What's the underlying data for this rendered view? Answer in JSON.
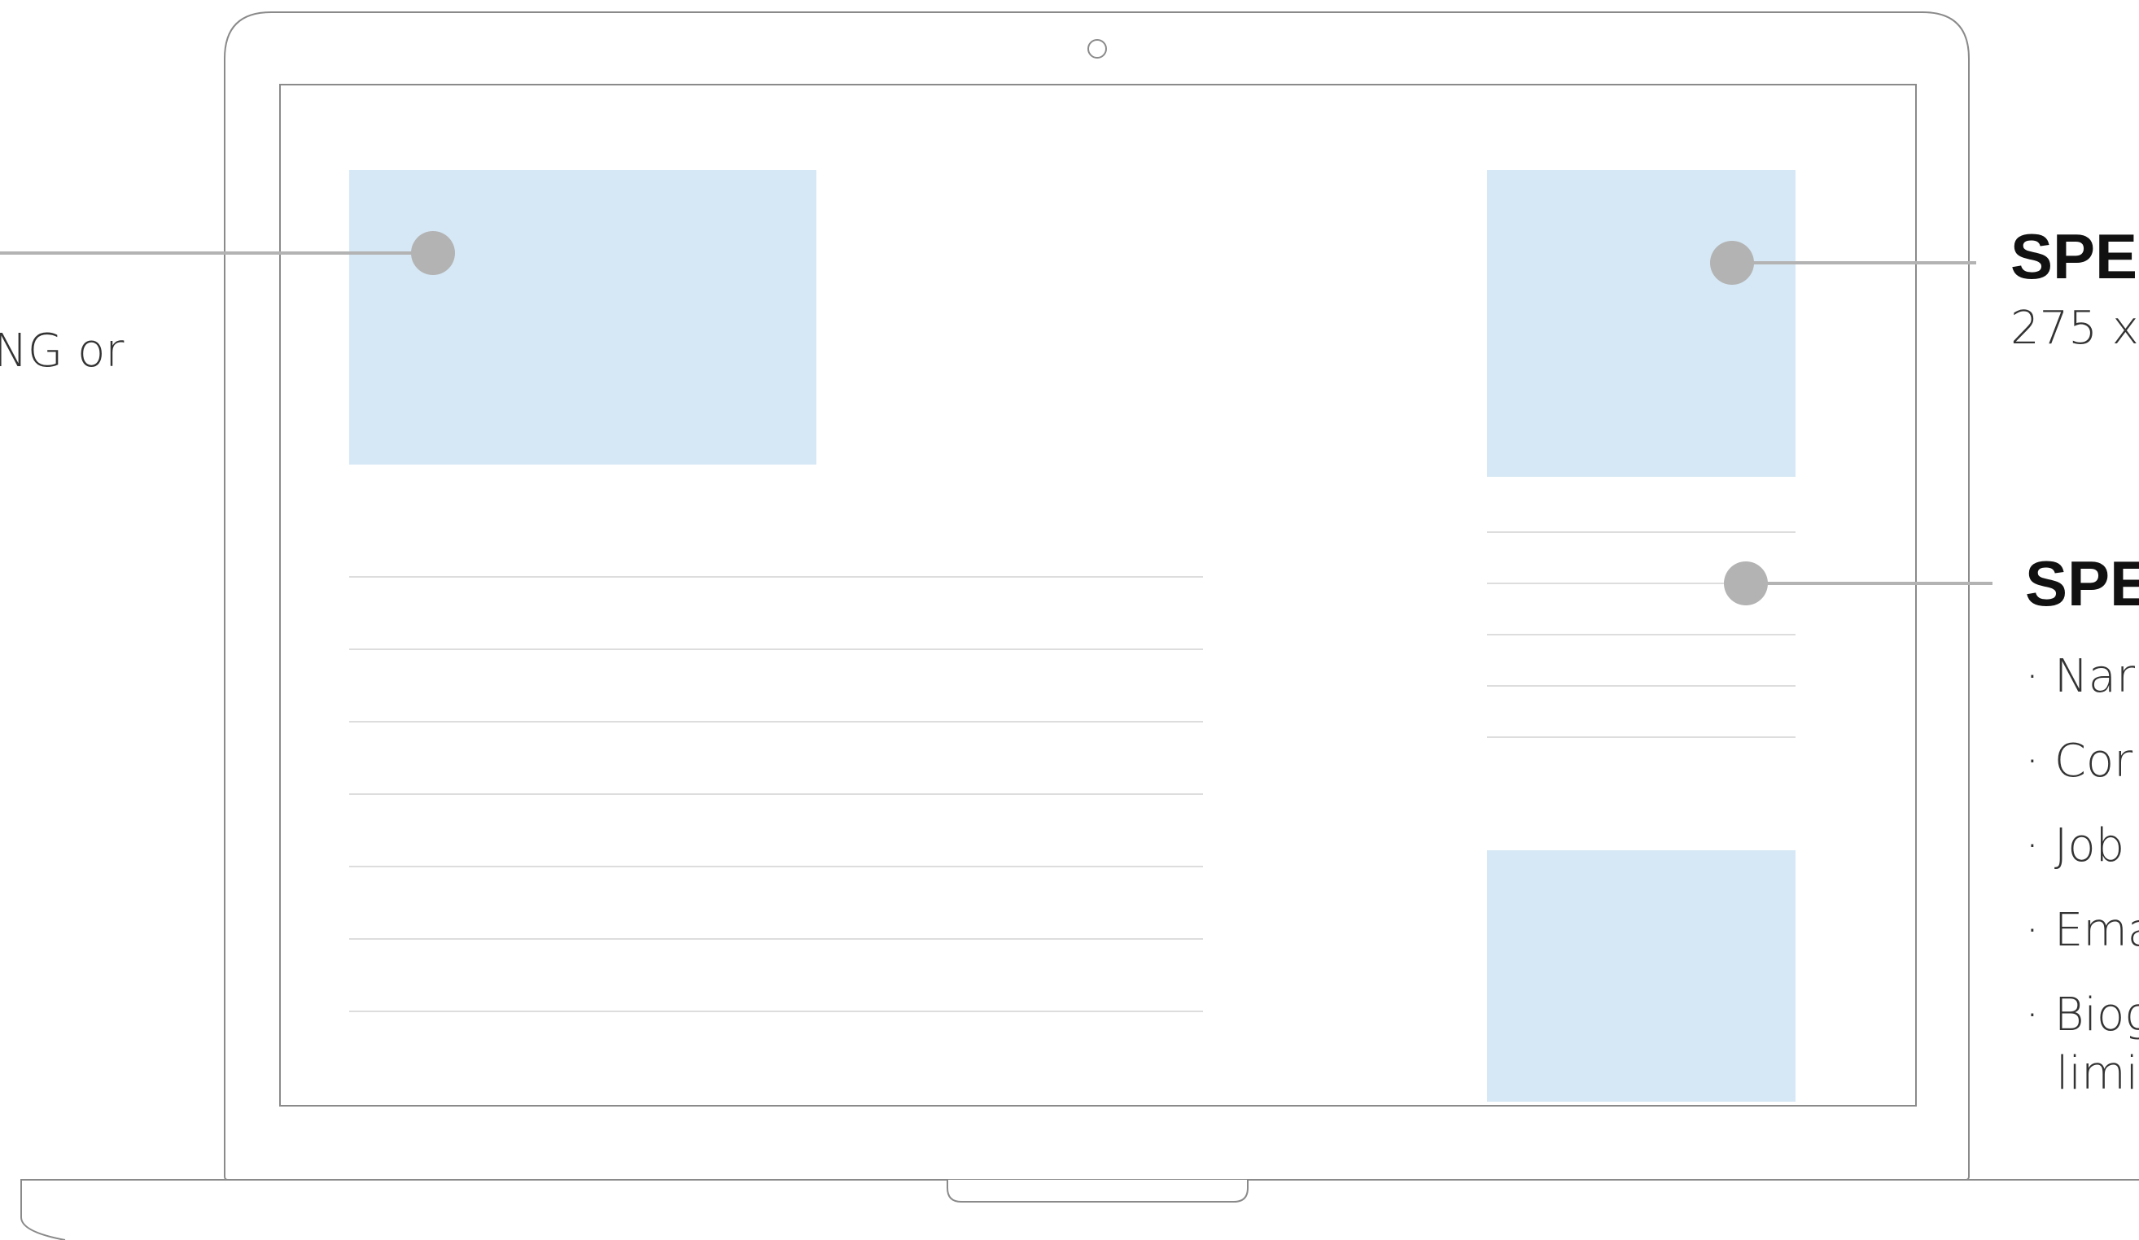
{
  "callouts": {
    "left": {
      "text": "NG or"
    },
    "right_top": {
      "title": "SPE",
      "text": "275 x"
    },
    "right_mid": {
      "title": "SPE",
      "items": [
        "Nar",
        "Cor",
        "Job",
        "Ema",
        "Biog"
      ],
      "continuation": "limi"
    }
  },
  "colors": {
    "placeholder_fill": "#d6e8f5",
    "outline": "#8a8a8a",
    "connector": "#b3b3b3",
    "text_line": "#dddddd"
  }
}
